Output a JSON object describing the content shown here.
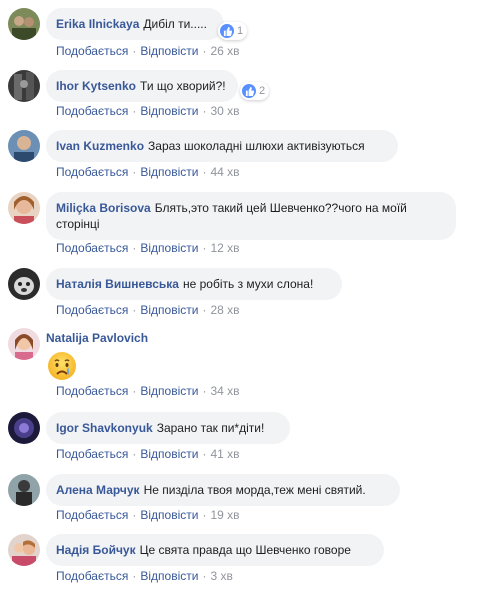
{
  "actions": {
    "like": "Подобається",
    "reply": "Відповісти",
    "separator": "·"
  },
  "colors": {
    "link": "#385898",
    "bubble": "#f2f3f5",
    "like": "#5890ff",
    "meta": "#90949c"
  },
  "comments": [
    {
      "author": "Erika Ilnickaya",
      "text": "Дибіл ти.....",
      "reactions": "1",
      "time": "26 хв"
    },
    {
      "author": "Ihor Kytsenko",
      "text": "Ти що хворий?!",
      "reactions": "2",
      "time": "30 хв"
    },
    {
      "author": "Ivan Kuzmenko",
      "text": "Зараз шоколадні шлюхи активізуються",
      "time": "44 хв"
    },
    {
      "author": "Miliçka Borisova",
      "text_line1": "Блять,это такий цей Шевченко??чого на моїй",
      "text_line2": "сторінці",
      "time": "12 хв"
    },
    {
      "author": "Наталія Вишневська",
      "text": "не робіть з мухи слона!",
      "time": "28 хв"
    },
    {
      "author": "Natalija Pavlovich",
      "emoji": "crying-face",
      "time": "34 хв"
    },
    {
      "author": "Igor Shavkonyuk",
      "text": "Зарано так пи*діти!",
      "time": "41 хв"
    },
    {
      "author": "Алена Марчук",
      "text": "Не пизділа твоя морда,теж мені святий.",
      "time": "19 хв"
    },
    {
      "author": "Надія Бойчук",
      "text": "Це свята правда що Шевченко говоре",
      "time": "3 хв"
    }
  ]
}
